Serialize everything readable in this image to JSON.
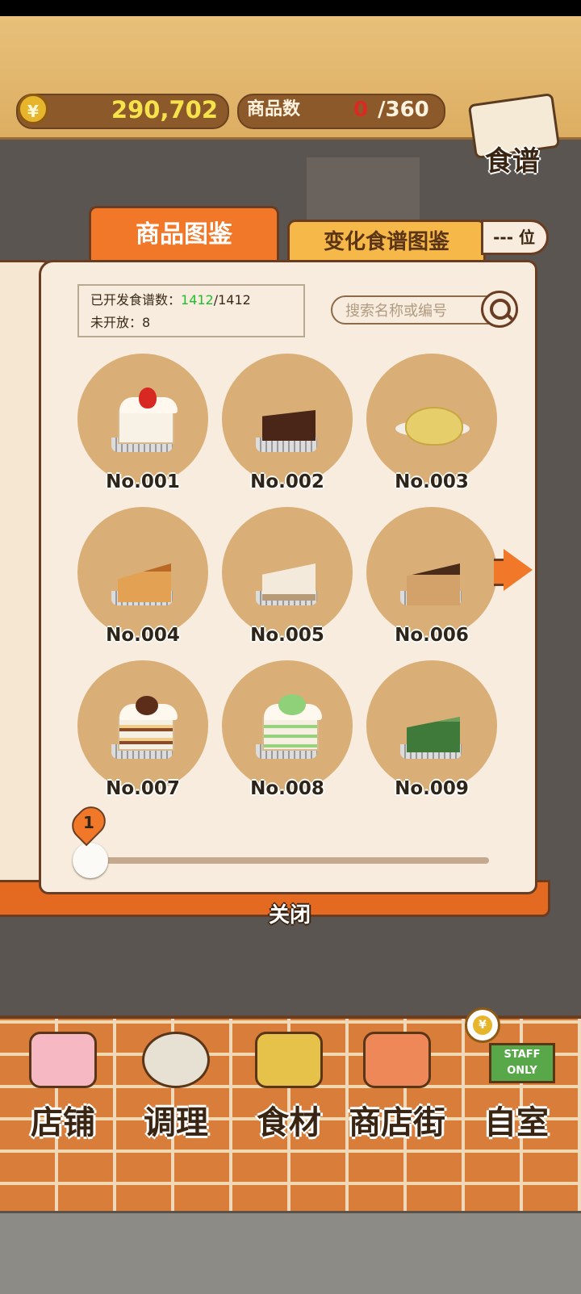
{
  "top_bar": {
    "currency_symbol": "¥",
    "coins": "290,702",
    "product_count_label": "商品数",
    "product_count_current": "0",
    "product_count_max": "/360",
    "recipe_button_label": "食谱"
  },
  "tabs": {
    "active": "商品图鉴",
    "inactive": "变化食谱图鉴",
    "rank_label": "--- 位"
  },
  "info": {
    "developed_label": "已开发食谱数：",
    "developed_current": "1412",
    "developed_total": "/1412",
    "unopened_label": "未开放：",
    "unopened_value": "8"
  },
  "search": {
    "placeholder": "搜索名称或编号"
  },
  "items": [
    {
      "label": "No.001",
      "cake": "strawberry-shortcake"
    },
    {
      "label": "No.002",
      "cake": "chocolate-cake"
    },
    {
      "label": "No.003",
      "cake": "custard-cake"
    },
    {
      "label": "No.004",
      "cake": "baked-cheesecake"
    },
    {
      "label": "No.005",
      "cake": "rare-cheesecake"
    },
    {
      "label": "No.006",
      "cake": "basque-cheesecake"
    },
    {
      "label": "No.007",
      "cake": "chestnut-cake"
    },
    {
      "label": "No.008",
      "cake": "melon-shortcake"
    },
    {
      "label": "No.009",
      "cake": "matcha-cake"
    }
  ],
  "pagination": {
    "current_page": "1"
  },
  "close_label": "关闭",
  "nav": [
    {
      "label": "店铺",
      "icon": "shop-cake-icon"
    },
    {
      "label": "调理",
      "icon": "mixing-bowl-icon"
    },
    {
      "label": "食材",
      "icon": "ingredient-bag-icon"
    },
    {
      "label": "商店街",
      "icon": "shopping-street-icon"
    },
    {
      "label": "自室",
      "icon": "staff-room-icon"
    }
  ],
  "staff_sign": "STAFF ONLY",
  "colors": {
    "accent_orange": "#f07828",
    "coin_yellow": "#f6e24a",
    "count_red": "#d92a22",
    "green_value": "#1fbf2f"
  }
}
